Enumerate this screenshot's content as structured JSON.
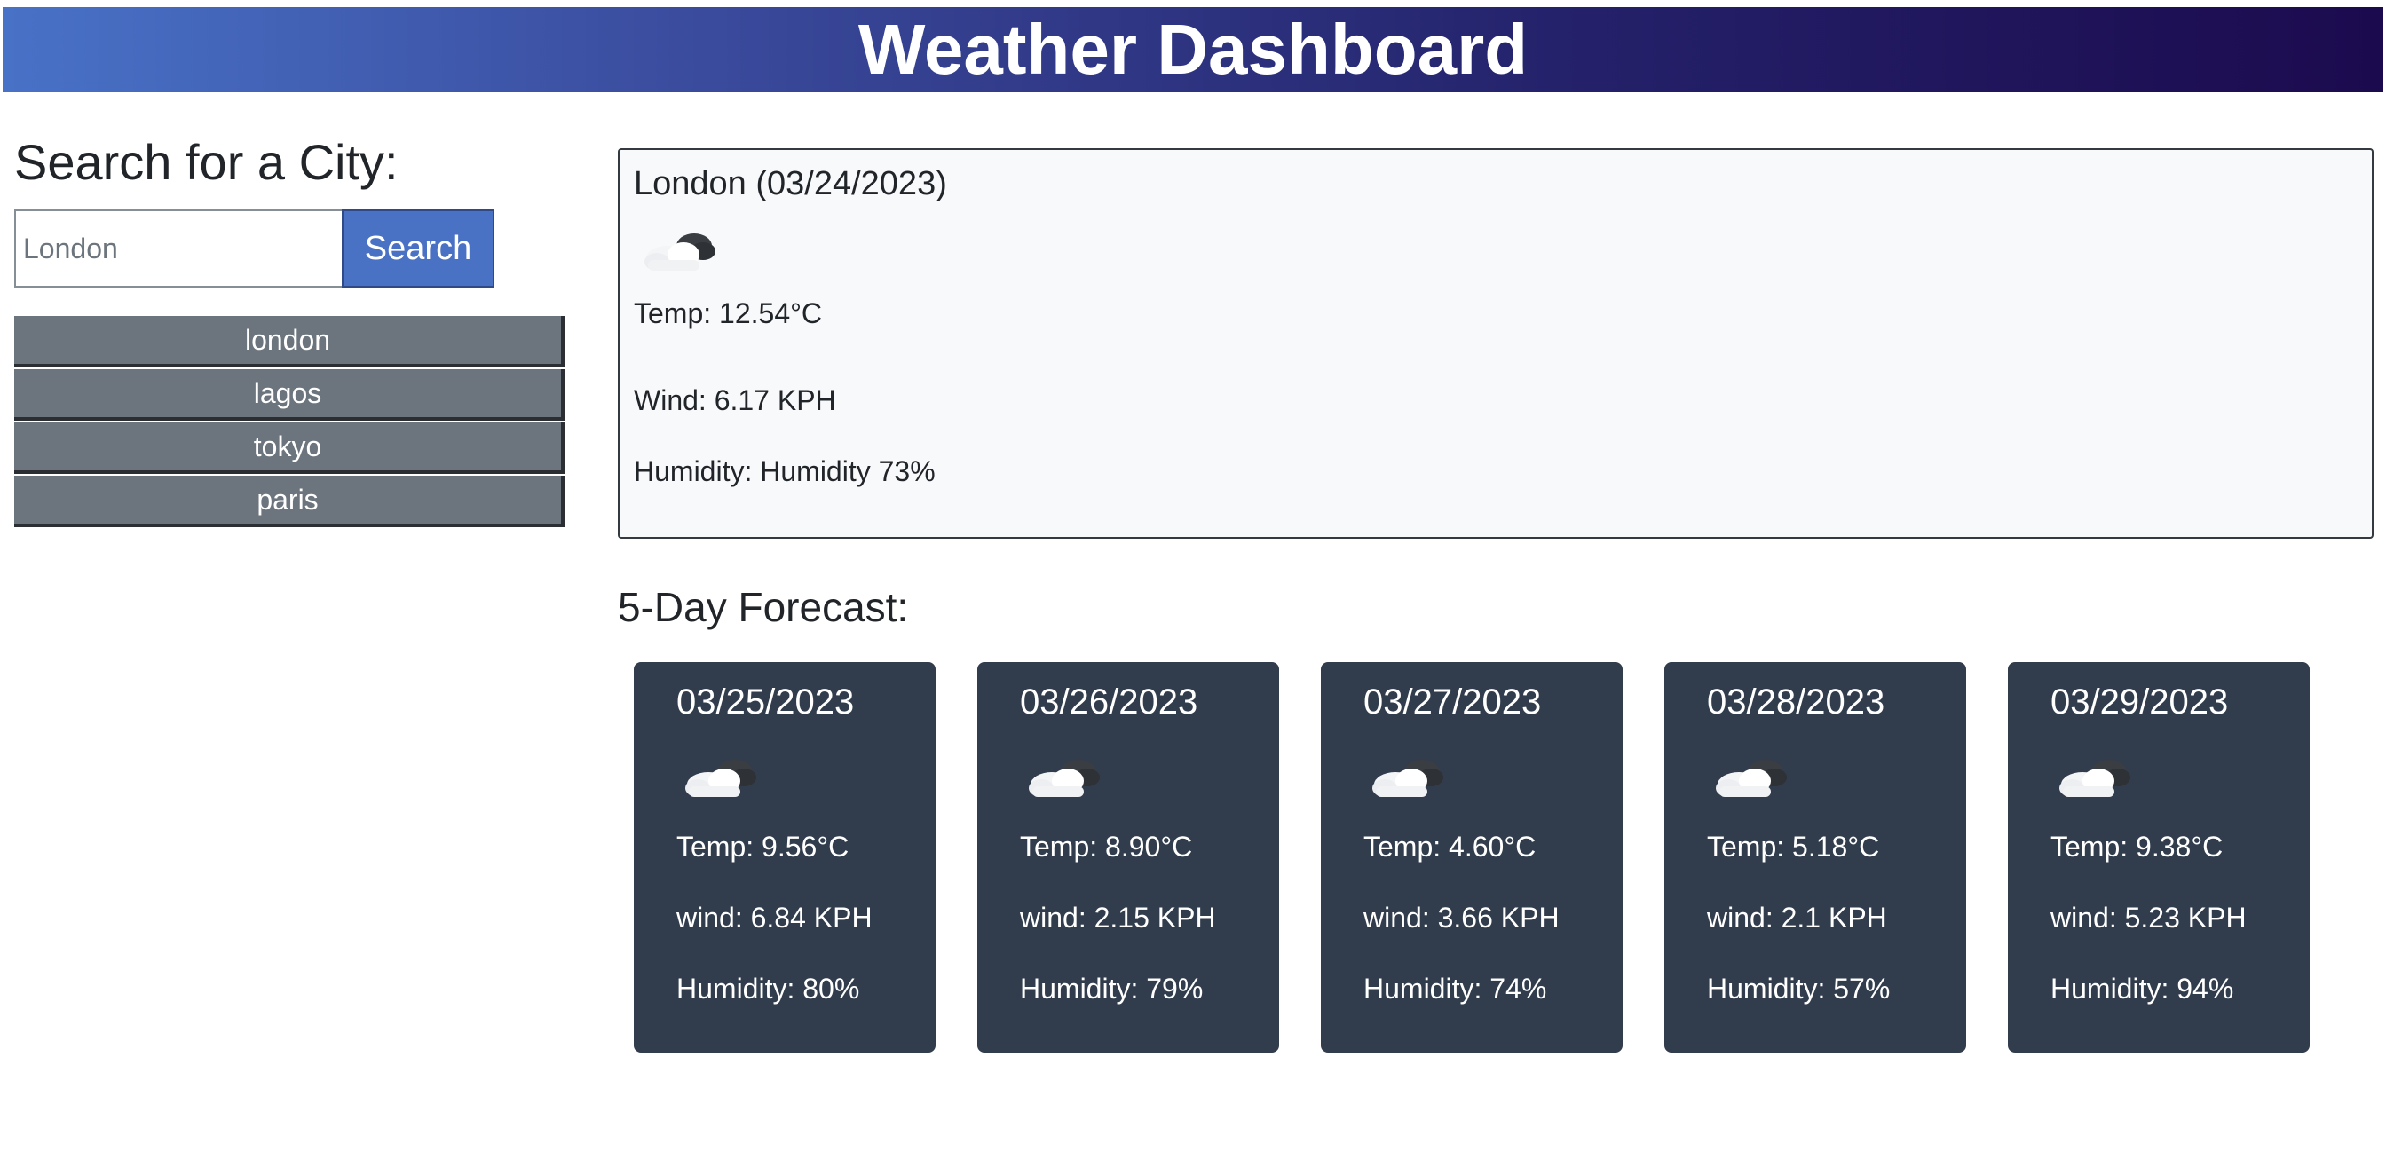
{
  "header": {
    "title": "Weather Dashboard"
  },
  "search": {
    "heading": "Search for a City:",
    "value": "",
    "placeholder": "London",
    "button_label": "Search"
  },
  "history": [
    {
      "label": "london"
    },
    {
      "label": "lagos"
    },
    {
      "label": "tokyo"
    },
    {
      "label": "paris"
    }
  ],
  "current": {
    "title": "London (03/24/2023)",
    "icon": "cloud-icon",
    "temp": "Temp: 12.54°C",
    "wind": "Wind: 6.17 KPH",
    "humidity": "Humidity: Humidity 73%"
  },
  "forecast": {
    "heading": "5-Day Forecast:",
    "days": [
      {
        "date": "03/25/2023",
        "icon": "cloud-icon",
        "temp": "Temp: 9.56°C",
        "wind": "wind: 6.84 KPH",
        "humidity": "Humidity: 80%"
      },
      {
        "date": "03/26/2023",
        "icon": "cloud-icon",
        "temp": "Temp: 8.90°C",
        "wind": "wind: 2.15 KPH",
        "humidity": "Humidity: 79%"
      },
      {
        "date": "03/27/2023",
        "icon": "cloud-icon",
        "temp": "Temp: 4.60°C",
        "wind": "wind: 3.66 KPH",
        "humidity": "Humidity: 74%"
      },
      {
        "date": "03/28/2023",
        "icon": "cloud-icon",
        "temp": "Temp: 5.18°C",
        "wind": "wind: 2.1 KPH",
        "humidity": "Humidity: 57%"
      },
      {
        "date": "03/29/2023",
        "icon": "cloud-icon",
        "temp": "Temp: 9.38°C",
        "wind": "wind: 5.23 KPH",
        "humidity": "Humidity: 94%"
      }
    ]
  },
  "colors": {
    "header_start": "#4872c7",
    "header_end": "#1c0a4e",
    "search_button": "#4a72c4",
    "history_button": "#6c757d",
    "forecast_card": "#313d4d",
    "current_panel": "#f8f9fa"
  }
}
